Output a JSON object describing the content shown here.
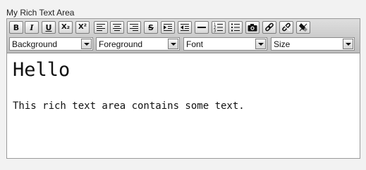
{
  "caption": "My Rich Text Area",
  "toolbar": {
    "buttons": [
      {
        "name": "bold-button",
        "icon": "bold-icon",
        "label": "B"
      },
      {
        "name": "italic-button",
        "icon": "italic-icon",
        "label": "I"
      },
      {
        "name": "underline-button",
        "icon": "underline-icon",
        "label": "U"
      },
      {
        "name": "subscript-button",
        "icon": "subscript-icon",
        "label": "X₂"
      },
      {
        "name": "superscript-button",
        "icon": "superscript-icon",
        "label": "X²"
      },
      {
        "name": "align-left-button",
        "icon": "align-left-icon"
      },
      {
        "name": "align-center-button",
        "icon": "align-center-icon"
      },
      {
        "name": "align-right-button",
        "icon": "align-right-icon"
      },
      {
        "name": "strikethrough-button",
        "icon": "strikethrough-icon",
        "label": "S"
      },
      {
        "name": "indent-button",
        "icon": "indent-icon"
      },
      {
        "name": "outdent-button",
        "icon": "outdent-icon"
      },
      {
        "name": "horizontal-rule-button",
        "icon": "horizontal-rule-icon"
      },
      {
        "name": "ordered-list-button",
        "icon": "ordered-list-icon"
      },
      {
        "name": "unordered-list-button",
        "icon": "unordered-list-icon"
      },
      {
        "name": "insert-image-button",
        "icon": "camera-icon"
      },
      {
        "name": "create-link-button",
        "icon": "link-icon"
      },
      {
        "name": "remove-link-button",
        "icon": "unlink-icon"
      },
      {
        "name": "remove-format-button",
        "icon": "eraser-icon"
      }
    ],
    "selects": {
      "background": "Background",
      "foreground": "Foreground",
      "font": "Font",
      "size": "Size"
    }
  },
  "content": {
    "heading": "Hello",
    "body": "This rich text area contains some text."
  }
}
